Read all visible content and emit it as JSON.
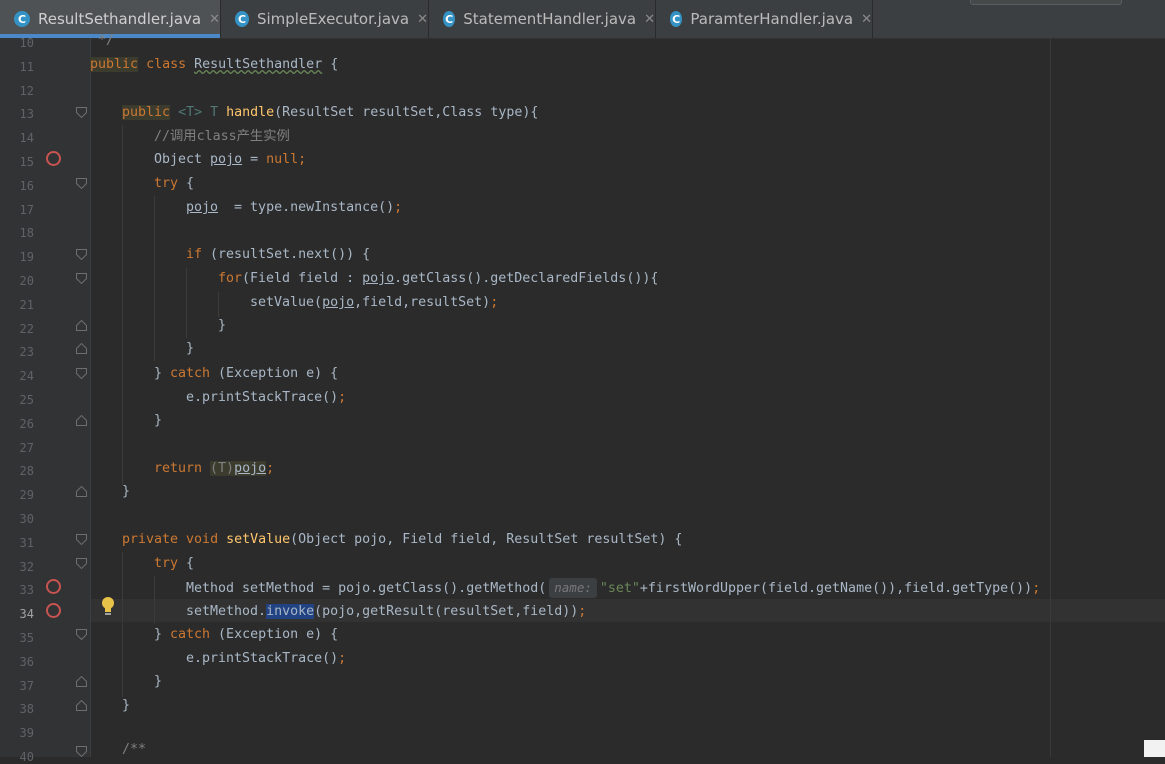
{
  "tabs": [
    {
      "label": "ResultSethandler.java",
      "icon": "C",
      "active": true
    },
    {
      "label": "SimpleExecutor.java",
      "icon": "C",
      "active": false
    },
    {
      "label": "StatementHandler.java",
      "icon": "C",
      "active": false
    },
    {
      "label": "ParamterHandler.java",
      "icon": "C",
      "active": false
    }
  ],
  "tab_close_glyph": "✕",
  "line_numbers": [
    "10",
    "11",
    "12",
    "13",
    "14",
    "15",
    "16",
    "17",
    "18",
    "19",
    "20",
    "21",
    "22",
    "23",
    "24",
    "25",
    "26",
    "27",
    "28",
    "29",
    "30",
    "31",
    "32",
    "33",
    "34",
    "35",
    "36",
    "37",
    "38",
    "39",
    "40"
  ],
  "code": {
    "l10": {
      "cm": "*/"
    },
    "l11": {
      "public": "public",
      "class": "class",
      "name": "ResultSethandler",
      "rest": " {"
    },
    "l13": {
      "public": "public",
      "generic": "<T>",
      "t": " T ",
      "fn": "handle",
      "sig": "(ResultSet resultSet,Class type){"
    },
    "l14": {
      "cm": "//调用class产生实例"
    },
    "l15": {
      "a": "Object ",
      "pojo": "pojo",
      "b": " = ",
      "null": "null",
      "semi": ";"
    },
    "l16": {
      "try": "try",
      "rest": " {"
    },
    "l17": {
      "pojo": "pojo",
      "rest": "  = type.newInstance()",
      "semi": ";"
    },
    "l19": {
      "if": "if",
      "rest": " (resultSet.next()) {"
    },
    "l20": {
      "for": "for",
      "a": "(Field field : ",
      "pojo": "pojo",
      "b": ".getClass().getDeclaredFields()){"
    },
    "l21": {
      "a": "setValue(",
      "pojo": "pojo",
      "b": ",field,resultSet)",
      "semi": ";"
    },
    "l22": {
      "a": "}"
    },
    "l23": {
      "a": "}"
    },
    "l24": {
      "a": "} ",
      "catch": "catch",
      "b": " (Exception e) {"
    },
    "l25": {
      "a": "e.printStackTrace()",
      "semi": ";"
    },
    "l26": {
      "a": "}"
    },
    "l28": {
      "return": "return ",
      "cast": "(T)",
      "pojo": "pojo",
      "semi": ";"
    },
    "l29": {
      "a": "}"
    },
    "l31": {
      "private": "private ",
      "void": "void ",
      "fn": "setValue",
      "sig": "(Object pojo, Field field, ResultSet resultSet) {"
    },
    "l32": {
      "try": "try",
      "rest": " {"
    },
    "l33": {
      "a": "Method setMethod = pojo.getClass().getMethod(",
      "hint": "name:",
      "str": "\"set\"",
      "b": "+firstWordUpper(field.getName()),field.getType())",
      "semi": ";"
    },
    "l34": {
      "a": "setMethod.",
      "sel": "invoke",
      "b": "(pojo,getResult(resultSet,field))",
      "semi": ";"
    },
    "l35": {
      "a": "} ",
      "catch": "catch",
      "b": " (Exception e) {"
    },
    "l36": {
      "a": "e.printStackTrace()",
      "semi": ";"
    },
    "l37": {
      "a": "}"
    },
    "l38": {
      "a": "}"
    },
    "l40": {
      "cm": "/**"
    }
  },
  "breakpoint_lines": [
    "15",
    "33",
    "34"
  ],
  "current_line": "34",
  "colors": {
    "keyword": "#cc7832",
    "function": "#ffc66d",
    "comment": "#808080",
    "string": "#6a8759",
    "text": "#a9b7c6",
    "breakpoint": "#c75450",
    "accent": "#4a88c7"
  }
}
